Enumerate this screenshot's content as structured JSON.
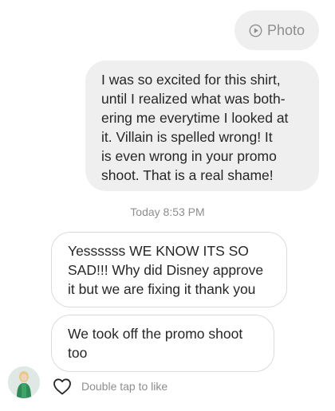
{
  "header": {
    "photo_label": "Photo",
    "photo_icon": "play-circle-icon"
  },
  "sent_message": {
    "lines": [
      "I was so excited for this shirt,",
      "until I realized what was both-",
      "ering me everytime I looked at",
      "it.  Villain is spelled wrong! It",
      "is even wrong in your promo",
      "shoot.  That is a real shame!"
    ]
  },
  "timestamp": "Today 8:53 PM",
  "received_messages": [
    {
      "lines": [
        "Yessssss WE KNOW ITS SO",
        "SAD!!! Why did Disney approve",
        "it but we are fixing it thank you"
      ]
    },
    {
      "lines": [
        "We took off the promo shoot",
        "too"
      ]
    }
  ],
  "footer": {
    "like_hint": "Double tap to like",
    "like_icon": "heart-outline-icon",
    "avatar_icon": "profile-avatar"
  },
  "colors": {
    "bubble_gray": "#efefef",
    "border": "#dbdbdb",
    "muted_text": "#8e8e8e",
    "text": "#262626"
  }
}
